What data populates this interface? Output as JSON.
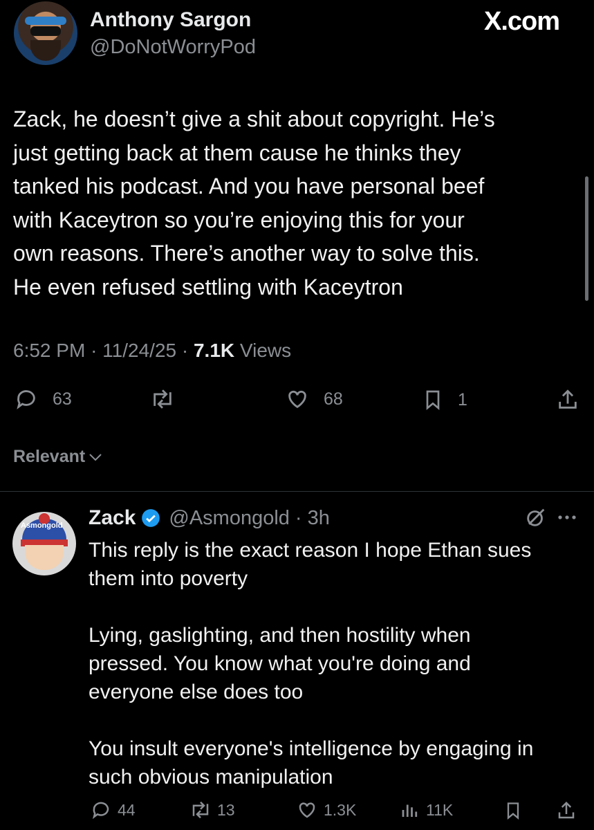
{
  "brand": "X.com",
  "tweet": {
    "author_name": "Anthony Sargon",
    "author_handle": "@DoNotWorryPod",
    "text_lines": [
      "Zack, he doesn’t give a shit about copyright. He’s",
      "just getting back at them cause he thinks they",
      "tanked his podcast. And you have personal beef",
      "with Kaceytron so you’re enjoying this for your",
      "own reasons. There’s another way to solve this.",
      "He even refused settling with Kaceytron"
    ],
    "time": "6:52 PM",
    "date": "11/24/25",
    "views": "7.1K",
    "views_label": "Views",
    "replies": "63",
    "likes": "68",
    "bookmarks": "1",
    "icons": [
      "reply-icon",
      "retweet-icon",
      "like-icon",
      "bookmark-icon",
      "share-icon"
    ]
  },
  "sort_label": "Relevant",
  "reply": {
    "author_name": "Zack",
    "author_handle": "@Asmongold",
    "age": "3h",
    "avatar_text": "Asmongold",
    "verified_color": "#1d9bf0",
    "text_lines": [
      "This reply is the exact reason I hope Ethan sues",
      "them into poverty",
      "",
      "Lying, gaslighting, and then hostility when",
      "pressed. You know what you're doing and",
      "everyone else does too",
      "",
      "You insult everyone's intelligence by engaging in",
      "such obvious manipulation"
    ],
    "replies": "44",
    "retweets": "13",
    "likes": "1.3K",
    "views": "11K"
  }
}
